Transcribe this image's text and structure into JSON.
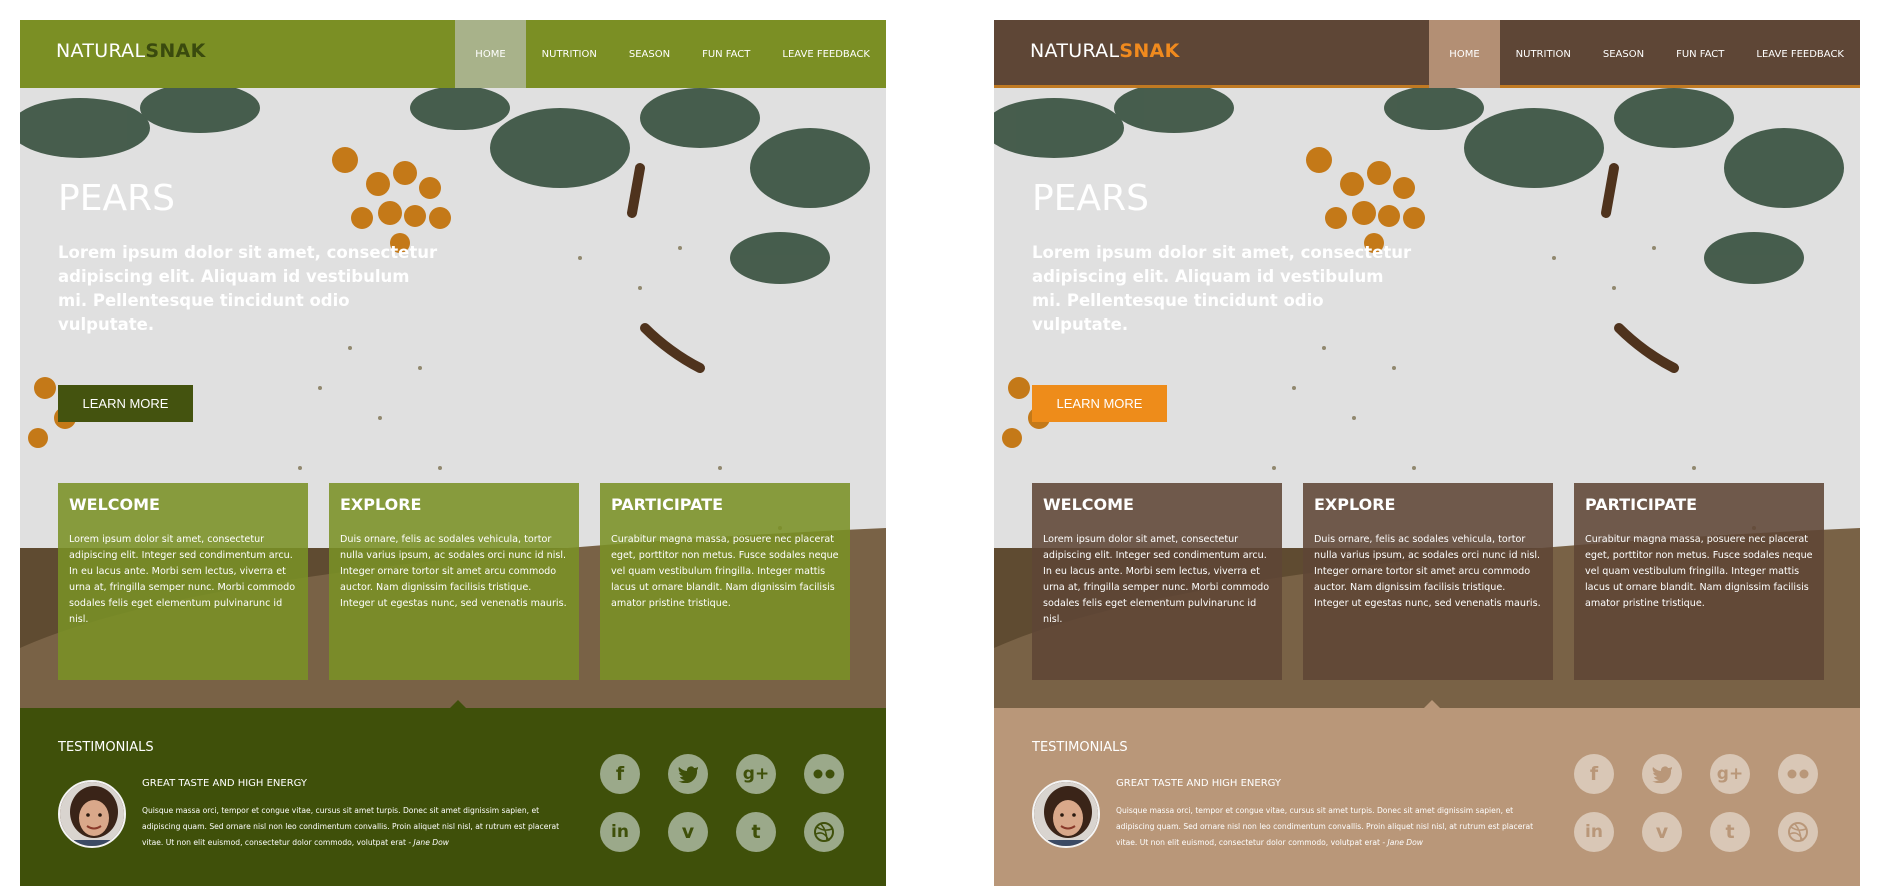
{
  "mockups": [
    {
      "variant": "green",
      "logo": {
        "part1": "NATURAL",
        "part2": "SNAK"
      },
      "nav": [
        "HOME",
        "NUTRITION",
        "SEASON",
        "FUN FACT",
        "LEAVE FEEDBACK"
      ],
      "hero": {
        "title": "PEARS",
        "text": "Lorem ipsum dolor sit amet, consectetur adipiscing elit. Aliquam id vestibulum mi. Pellentesque tincidunt odio vulputate.",
        "button": "LEARN MORE"
      },
      "cards": [
        {
          "title": "WELCOME",
          "text": "Lorem ipsum dolor sit amet, consectetur adipiscing elit. Integer sed condimentum arcu. In eu lacus ante. Morbi sem lectus, viverra et urna at, fringilla semper nunc. Morbi commodo sodales felis eget elementum pulvinarunc id nisl."
        },
        {
          "title": "EXPLORE",
          "text": "Duis ornare, felis ac sodales vehicula, tortor nulla varius ipsum, ac sodales orci nunc id nisl. Integer ornare tortor sit amet arcu commodo auctor. Nam dignissim facilisis tristique. Integer ut egestas nunc, sed venenatis mauris."
        },
        {
          "title": "PARTICIPATE",
          "text": "Curabitur magna massa, posuere nec placerat eget, porttitor non metus. Fusce sodales neque vel quam vestibulum fringilla. Integer mattis lacus ut ornare blandit. Nam dignissim facilisis amator pristine tristique."
        }
      ],
      "testimonials": {
        "title": "TESTIMONIALS",
        "heading": "GREAT TASTE AND HIGH ENERGY",
        "quote": "Quisque massa orci, tempor et congue vitae, cursus sit amet turpis. Donec sit amet dignissim sapien, et adipiscing quam. Sed ornare nisl non leo condimentum convallis. Proin aliquet nisl nisl, at rutrum est placerat vitae. Ut non elit euismod, consectetur dolor commodo, volutpat erat",
        "author": " - Jane Dow"
      },
      "social": [
        "facebook-icon",
        "twitter-icon",
        "google-plus-icon",
        "flickr-icon",
        "linkedin-icon",
        "vimeo-icon",
        "tumblr-icon",
        "dribbble-icon"
      ],
      "colors": {
        "nav": "#7b8f24",
        "accent": "#44530f",
        "card": "#7a9125",
        "footer": "#3f500a"
      }
    },
    {
      "variant": "brown",
      "logo": {
        "part1": "NATURAL",
        "part2": "SNAK"
      },
      "nav": [
        "HOME",
        "NUTRITION",
        "SEASON",
        "FUN FACT",
        "LEAVE FEEDBACK"
      ],
      "hero": {
        "title": "PEARS",
        "text": "Lorem ipsum dolor sit amet, consectetur adipiscing elit. Aliquam id vestibulum mi. Pellentesque tincidunt odio vulputate.",
        "button": "LEARN MORE"
      },
      "cards": [
        {
          "title": "WELCOME",
          "text": "Lorem ipsum dolor sit amet, consectetur adipiscing elit. Integer sed condimentum arcu. In eu lacus ante. Morbi sem lectus, viverra et urna at, fringilla semper nunc. Morbi commodo sodales felis eget elementum pulvinarunc id nisl."
        },
        {
          "title": "EXPLORE",
          "text": "Duis ornare, felis ac sodales vehicula, tortor nulla varius ipsum, ac sodales orci nunc id nisl. Integer ornare tortor sit amet arcu commodo auctor. Nam dignissim facilisis tristique. Integer ut egestas nunc, sed venenatis mauris."
        },
        {
          "title": "PARTICIPATE",
          "text": "Curabitur magna massa, posuere nec placerat eget, porttitor non metus. Fusce sodales neque vel quam vestibulum fringilla. Integer mattis lacus ut ornare blandit. Nam dignissim facilisis amator pristine tristique."
        }
      ],
      "testimonials": {
        "title": "TESTIMONIALS",
        "heading": "GREAT TASTE AND HIGH ENERGY",
        "quote": "Quisque massa orci, tempor et congue vitae, cursus sit amet turpis. Donec sit amet dignissim sapien, et adipiscing quam. Sed ornare nisl non leo condimentum convallis. Proin aliquet nisl nisl, at rutrum est placerat vitae. Ut non elit euismod, consectetur dolor commodo, volutpat erat",
        "author": " - Jane Dow"
      },
      "social": [
        "facebook-icon",
        "twitter-icon",
        "google-plus-icon",
        "flickr-icon",
        "linkedin-icon",
        "vimeo-icon",
        "tumblr-icon",
        "dribbble-icon"
      ],
      "colors": {
        "nav": "#5e4636",
        "accent": "#ee8c1a",
        "card": "#5e4636",
        "footer": "#b99779"
      }
    }
  ]
}
